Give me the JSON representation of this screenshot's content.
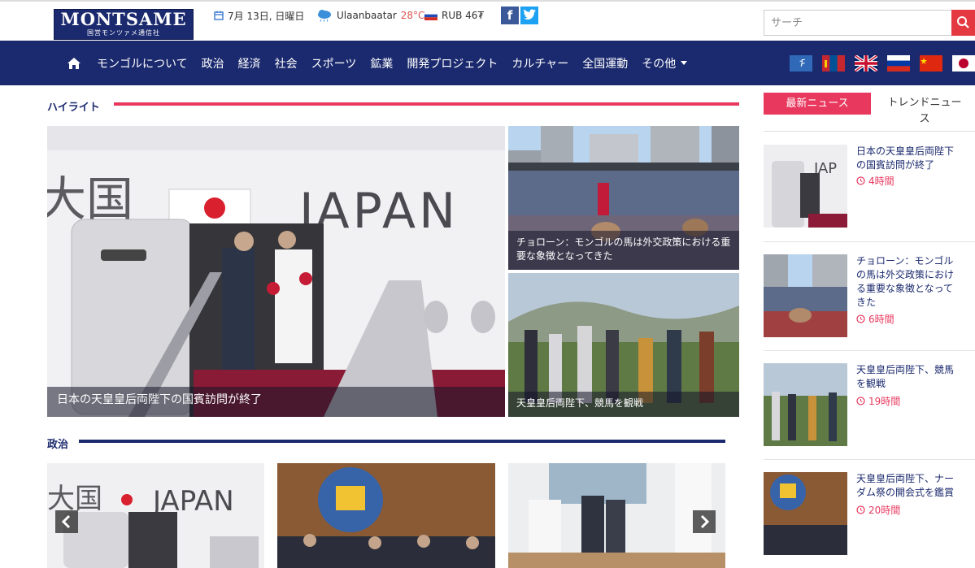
{
  "header": {
    "logo_text": "MONTSAME",
    "logo_sub": "国営モンツァメ通信社",
    "date": "7月 13日, 日曜日",
    "city": "Ulaanbaatar",
    "temperature": "28°C",
    "currency": "RUB 46₮",
    "search_placeholder": "サーチ"
  },
  "nav": {
    "items": [
      "モンゴルについて",
      "政治",
      "経済",
      "社会",
      "スポーツ",
      "鉱業",
      "開発プロジェクト",
      "カルチャー",
      "全国運動",
      "その他"
    ]
  },
  "highlight": {
    "title": "ハイライト",
    "main_caption": "日本の天皇皇后両陛下の国賓訪問が終了",
    "side1_caption": "チョローン：モンゴルの馬は外交政策における重要な象徴となってきた",
    "side2_caption": "天皇皇后両陛下、競馬を観戦"
  },
  "politics": {
    "title": "政治"
  },
  "sidebar": {
    "tab_latest": "最新ニュース",
    "tab_trend": "トレンドニュース",
    "news": [
      {
        "title": "日本の天皇皇后両陛下の国賓訪問が終了",
        "time": "4時間"
      },
      {
        "title": "チョローン：モンゴルの馬は外交政策における重要な象徴となってきた",
        "time": "6時間"
      },
      {
        "title": "天皇皇后両陛下、競馬を観戦",
        "time": "19時間"
      },
      {
        "title": "天皇皇后両陛下、ナーダム祭の開会式を鑑賞",
        "time": "20時間"
      }
    ]
  },
  "colors": {
    "navy": "#1b2a6e",
    "accent": "#e8385e",
    "search_red": "#e53941"
  },
  "icons": [
    "calendar-icon",
    "weather-icon",
    "ruble-flag-icon",
    "facebook-icon",
    "twitter-icon",
    "search-icon",
    "home-icon",
    "clock-icon",
    "chevron-left-icon",
    "chevron-right-icon"
  ]
}
